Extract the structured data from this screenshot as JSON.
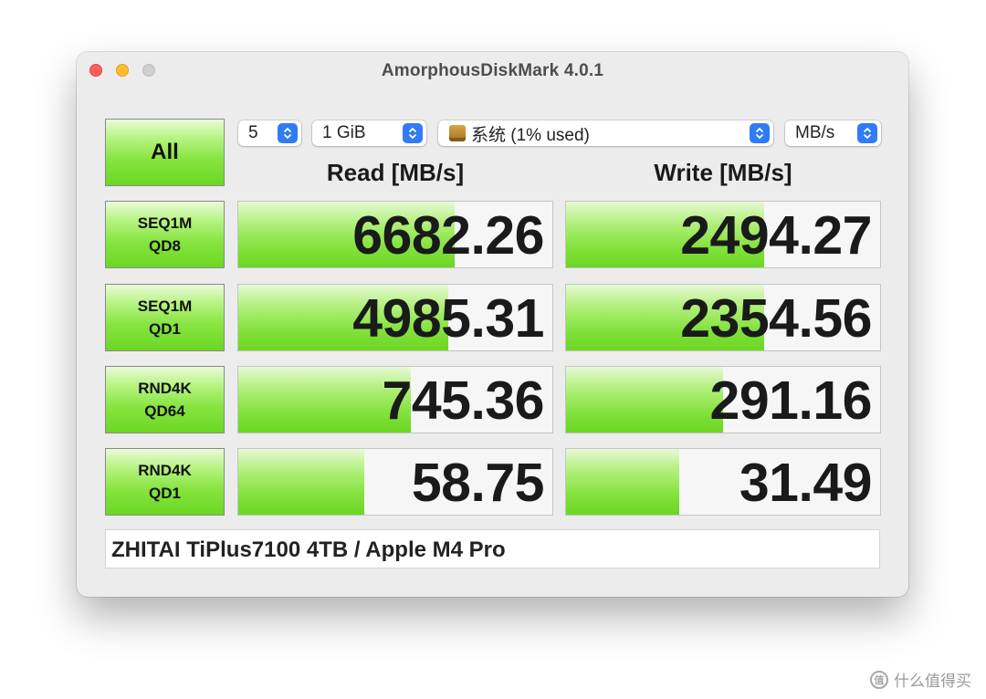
{
  "window": {
    "title": "AmorphousDiskMark 4.0.1"
  },
  "controls": {
    "all_label": "All",
    "count": "5",
    "size": "1 GiB",
    "volume": "系统 (1% used)",
    "unit": "MB/s"
  },
  "headers": {
    "read": "Read [MB/s]",
    "write": "Write [MB/s]"
  },
  "tests": [
    {
      "line1": "SEQ1M",
      "line2": "QD8",
      "read": "6682.26",
      "write": "2494.27",
      "read_fill": 0.69,
      "write_fill": 0.63
    },
    {
      "line1": "SEQ1M",
      "line2": "QD1",
      "read": "4985.31",
      "write": "2354.56",
      "read_fill": 0.67,
      "write_fill": 0.63
    },
    {
      "line1": "RND4K",
      "line2": "QD64",
      "read": "745.36",
      "write": "291.16",
      "read_fill": 0.55,
      "write_fill": 0.5
    },
    {
      "line1": "RND4K",
      "line2": "QD1",
      "read": "58.75",
      "write": "31.49",
      "read_fill": 0.4,
      "write_fill": 0.36
    }
  ],
  "comment": "ZHITAI TiPlus7100 4TB / Apple M4 Pro",
  "watermark": "什么值得买"
}
